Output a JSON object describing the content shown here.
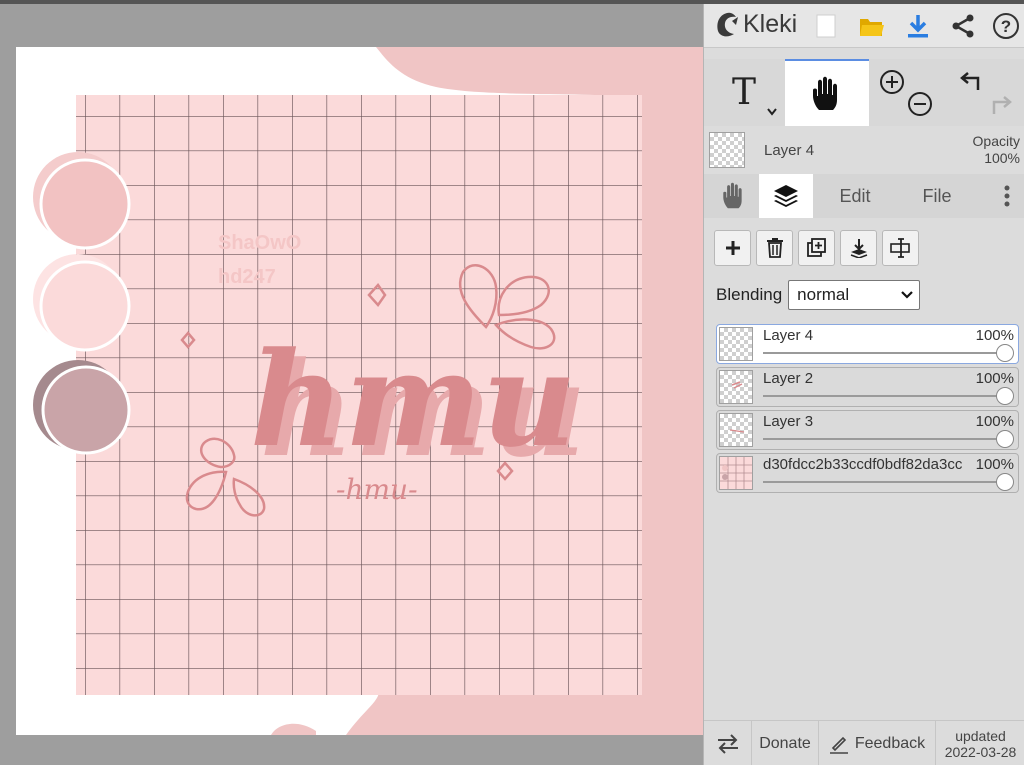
{
  "app": {
    "name": "Kleki"
  },
  "header": {
    "icons": [
      "new-image-icon",
      "open-folder-icon",
      "download-icon",
      "share-icon",
      "help-icon"
    ],
    "accent": "#2a7de1"
  },
  "tools": {
    "text_tool": "T",
    "active": "hand-tool"
  },
  "layer_info": {
    "name": "Layer 4",
    "opacity_label": "Opacity",
    "opacity_value": "100%"
  },
  "tabs": {
    "edit": "Edit",
    "file": "File"
  },
  "blending": {
    "label": "Blending",
    "value": "normal"
  },
  "layers": [
    {
      "name": "Layer 4",
      "opacity": "100%"
    },
    {
      "name": "Layer 2",
      "opacity": "100%"
    },
    {
      "name": "Layer 3",
      "opacity": "100%"
    },
    {
      "name": "d30fdcc2b33ccdf0bdf82da3cc",
      "opacity": "100%"
    }
  ],
  "footer": {
    "donate": "Donate",
    "feedback": "Feedback",
    "updated_label": "updated",
    "updated_date": "2022-03-28"
  },
  "artwork": {
    "watermark_line1": "ShaOwO",
    "watermark_line2": "hd247",
    "main_text": "hmu",
    "sub_text": "-hmu-",
    "colors": {
      "grid_bg": "#fbdada",
      "grid_line": "#6a5458",
      "blob": "#f0c5c5",
      "accent_text": "#d98a8d",
      "swatch1": "#f2c2c2",
      "swatch2": "#fbdada",
      "swatch3": "#c9a4a8"
    }
  }
}
